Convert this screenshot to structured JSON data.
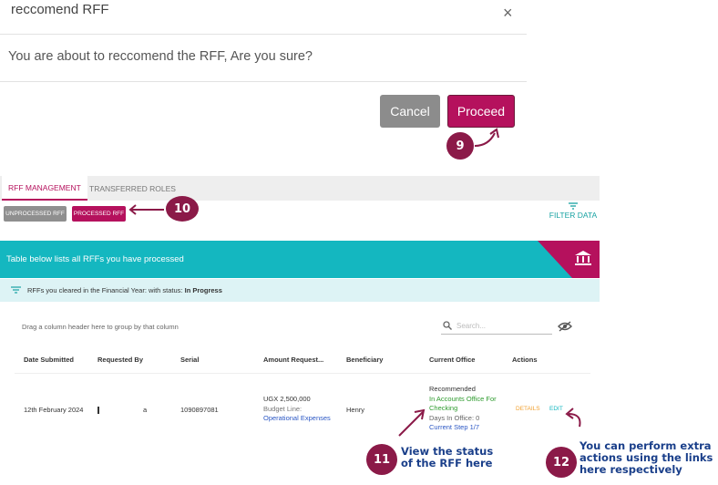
{
  "modal": {
    "title": "reccomend RFF",
    "close": "×",
    "message": "You are about to reccomend the RFF, Are you sure?",
    "cancel_label": "Cancel",
    "proceed_label": "Proceed"
  },
  "steps": {
    "s9": "9",
    "s10": "10",
    "s11": "11",
    "s12": "12"
  },
  "app": {
    "tabs": [
      "RFF MANAGEMENT",
      "TRANSFERRED ROLES"
    ],
    "unprocessed_label": "UNPROCESSED RFF",
    "processed_label": "PROCESSED RFF",
    "filter_label": "FILTER DATA",
    "band_text": "Table below lists all RFFs you have processed",
    "info_prefix": "RFFs you cleared in the Financial Year: with status:",
    "info_status": "In Progress",
    "drag_hint": "Drag a column header here to group by that column",
    "search_placeholder": "Search...",
    "columns": [
      "Date Submitted",
      "Requested By",
      "Serial",
      "Amount Request...",
      "Beneficiary",
      "Current Office",
      "Actions"
    ],
    "row": {
      "date": "12th February 2024",
      "requested_by": "a",
      "serial": "1090897081",
      "amount": "UGX 2,500,000",
      "budget_line_label": "Budget Line:",
      "budget_line_value": "Operational Expenses",
      "beneficiary": "Henry",
      "office_status": "Recommended",
      "office_location_1": "In Accounts Office For",
      "office_location_2": "Checking",
      "days_in_office": "Days In Office: 0",
      "current_step": "Current Step 1/7",
      "details_label": "DETAILS",
      "edit_label": "EDIT"
    }
  },
  "annotations": {
    "a11_line1": "View the status",
    "a11_line2": "of the RFF here",
    "a12_line1": "You can perform extra",
    "a12_line2": "actions using the links",
    "a12_line3": "here respectively"
  },
  "colors": {
    "brand": "#b5115d",
    "teal": "#14b7c0",
    "annotation": "#1a3f8a",
    "step_badge": "#8b1a48"
  }
}
